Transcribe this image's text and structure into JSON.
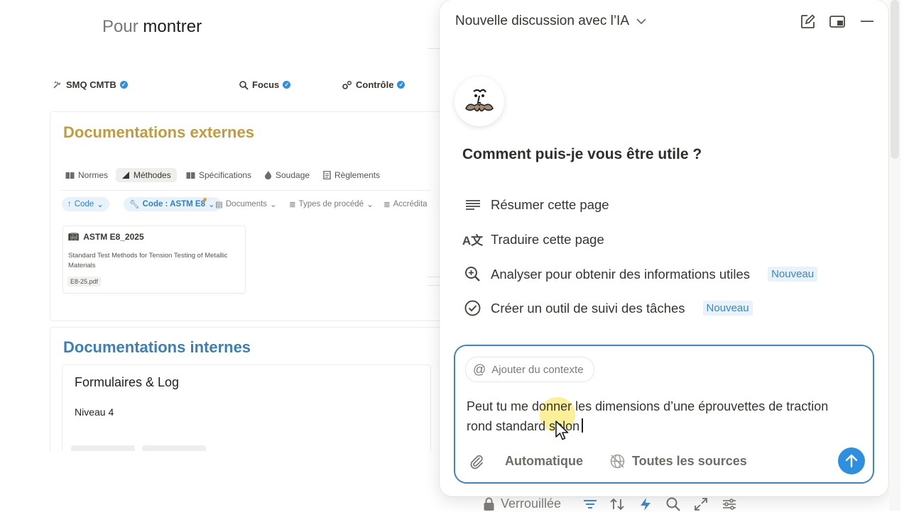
{
  "page": {
    "heading_prefix": "Pour",
    "heading_main": "montrer",
    "nav": [
      {
        "label": "SMQ CMTB",
        "icon": "tools-icon"
      },
      {
        "label": "Focus",
        "icon": "search-icon"
      },
      {
        "label": "Contrôle",
        "icon": "gears-icon"
      }
    ],
    "external": {
      "title": "Documentations externes",
      "tabs": [
        "Normes",
        "Méthodes",
        "Spécifications",
        "Soudage",
        "Règlements"
      ],
      "active_tab": "Méthodes",
      "filters": [
        "Code",
        "Code : ASTM E8",
        "Documents",
        "Types de procédé",
        "Accrédita"
      ],
      "doc": {
        "title": "ASTM E8_2025",
        "description": "Standard Test Methods for Tension Testing of Metallic Materials",
        "file": "E8-25.pdf"
      }
    },
    "internal": {
      "title": "Documentations internes",
      "section_title": "Formulaires & Log",
      "level": "Niveau 4"
    }
  },
  "ai_panel": {
    "title": "Nouvelle discussion avec l’IA",
    "greeting": "Comment puis-je vous être utile ?",
    "actions": [
      {
        "label": "Résumer cette page",
        "icon": "lines-icon",
        "badge": ""
      },
      {
        "label": "Traduire cette page",
        "icon": "translate-icon",
        "badge": ""
      },
      {
        "label": "Analyser pour obtenir des informations utiles",
        "icon": "zoom-in-icon",
        "badge": "Nouveau"
      },
      {
        "label": "Créer un outil de suivi des tâches",
        "icon": "check-circle-icon",
        "badge": "Nouveau"
      }
    ],
    "composer": {
      "context_label": "Ajouter du contexte",
      "text": "Peut tu me donner les dimensions d’une éprouvettes de traction rond standard selon",
      "mode_label": "Automatique",
      "sources_label": "Toutes les sources"
    },
    "footer": {
      "lock_label": "Verrouillée"
    },
    "colors": {
      "accent": "#2e8fe0",
      "composer_border": "#3a86c8",
      "badge_bg": "#e8f2fb",
      "external_title": "#c29b3d",
      "internal_title": "#3b7fb8"
    }
  }
}
